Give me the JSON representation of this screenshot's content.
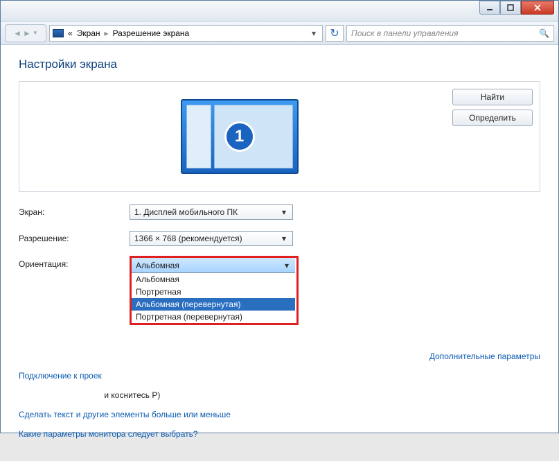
{
  "window": {
    "breadcrumb_root": "Экран",
    "breadcrumb_current": "Разрешение экрана",
    "search_placeholder": "Поиск в панели управления"
  },
  "page": {
    "heading": "Настройки экрана",
    "find_button": "Найти",
    "identify_button": "Определить",
    "monitor_badge": "1"
  },
  "form": {
    "screen_label": "Экран:",
    "screen_value": "1. Дисплей мобильного ПК",
    "resolution_label": "Разрешение:",
    "resolution_value": "1366 × 768 (рекомендуется)",
    "orientation_label": "Ориентация:",
    "orientation_value": "Альбомная",
    "orientation_options": [
      "Альбомная",
      "Портретная",
      "Альбомная (перевернутая)",
      "Портретная (перевернутая)"
    ]
  },
  "links": {
    "advanced": "Дополнительные параметры",
    "projector": "Подключение к проек",
    "projector_suffix": "и коснитесь P)",
    "textsize": "Сделать текст и другие элементы больше или меньше",
    "whichsettings": "Какие параметры монитора следует выбрать?"
  }
}
